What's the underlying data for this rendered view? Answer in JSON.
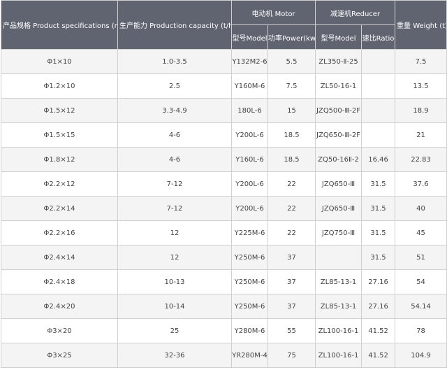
{
  "table": {
    "headers": {
      "spec": "产品规格 Product specifications (m)",
      "capacity": "生产能力 Production capacity (t/h)",
      "motor": "电动机 Motor",
      "reducer": "减速机Reducer",
      "weight": "重量 Weight (t)",
      "motor_model": "型号Model",
      "motor_power": "功率Power(kw)",
      "reducer_model": "型号Model",
      "reducer_ratio": "速比Ratio"
    },
    "rows": [
      {
        "spec": "Φ1×10",
        "capacity": "1.0-3.5",
        "motor_model": "Y132M2-6",
        "power": "5.5",
        "reducer_model": "ZL350-Ⅱ-25",
        "ratio": "",
        "weight": "7.5"
      },
      {
        "spec": "Φ1.2×10",
        "capacity": "2.5",
        "motor_model": "Y160M-6",
        "power": "7.5",
        "reducer_model": "ZL50-16-1",
        "ratio": "",
        "weight": "13.5"
      },
      {
        "spec": "Φ1.5×12",
        "capacity": "3.3-4.9",
        "motor_model": "180L-6",
        "power": "15",
        "reducer_model": "JZQ500-Ⅲ-2F",
        "ratio": "",
        "weight": "18.9"
      },
      {
        "spec": "Φ1.5×15",
        "capacity": "4-6",
        "motor_model": "Y200L-6",
        "power": "18.5",
        "reducer_model": "JZQ650-Ⅲ-2F",
        "ratio": "",
        "weight": "21"
      },
      {
        "spec": "Φ1.8×12",
        "capacity": "4-6",
        "motor_model": "Y160L-6",
        "power": "18.5",
        "reducer_model": "ZQ50-16Ⅱ-2",
        "ratio": "16.46",
        "weight": "22.83"
      },
      {
        "spec": "Φ2.2×12",
        "capacity": "7-12",
        "motor_model": "Y200L-6",
        "power": "22",
        "reducer_model": "JZQ650-Ⅲ",
        "ratio": "31.5",
        "weight": "37.6"
      },
      {
        "spec": "Φ2.2×14",
        "capacity": "7-12",
        "motor_model": "Y200L-6",
        "power": "22",
        "reducer_model": "JZQ650-Ⅲ",
        "ratio": "31.5",
        "weight": "40"
      },
      {
        "spec": "Φ2.2×16",
        "capacity": "12",
        "motor_model": "Y225M-6",
        "power": "22",
        "reducer_model": "JZQ750-Ⅲ",
        "ratio": "31.5",
        "weight": "45"
      },
      {
        "spec": "Φ2.4×14",
        "capacity": "12",
        "motor_model": "Y250M-6",
        "power": "37",
        "reducer_model": "",
        "ratio": "31.5",
        "weight": "51"
      },
      {
        "spec": "Φ2.4×18",
        "capacity": "10-13",
        "motor_model": "Y250M-6",
        "power": "37",
        "reducer_model": "ZL85-13-1",
        "ratio": "27.16",
        "weight": "54"
      },
      {
        "spec": "Φ2.4×20",
        "capacity": "10-14",
        "motor_model": "Y250M-6",
        "power": "37",
        "reducer_model": "ZL85-13-1",
        "ratio": "27.16",
        "weight": "54.14"
      },
      {
        "spec": "Φ3×20",
        "capacity": "25",
        "motor_model": "Y280M-6",
        "power": "55",
        "reducer_model": "ZL100-16-1",
        "ratio": "41.52",
        "weight": "78"
      },
      {
        "spec": "Φ3×25",
        "capacity": "32-36",
        "motor_model": "YR280M-4",
        "power": "75",
        "reducer_model": "ZL100-16-1",
        "ratio": "41.52",
        "weight": "104.9"
      }
    ]
  }
}
